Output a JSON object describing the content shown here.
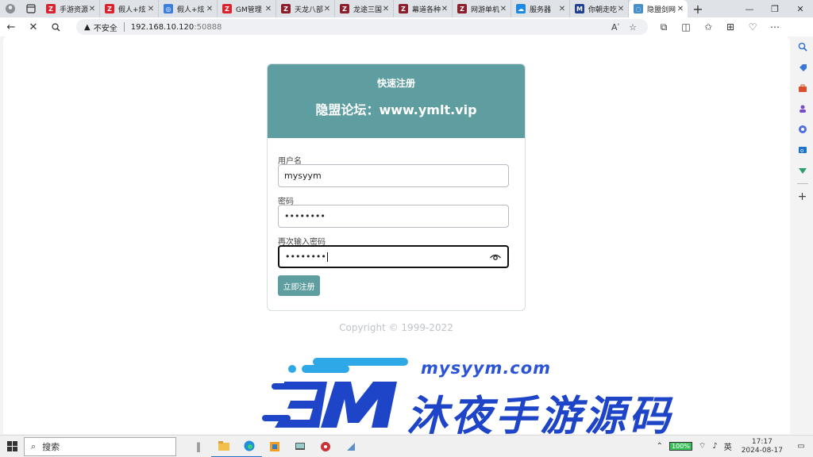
{
  "browser": {
    "tabs": [
      {
        "title": "手游资源",
        "favicon": "Z",
        "color": "#d9232e"
      },
      {
        "title": "假人+炫",
        "favicon": "Z",
        "color": "#d9232e"
      },
      {
        "title": "假人+炫",
        "favicon": "◎",
        "color": "#3b7ddd"
      },
      {
        "title": "GM管理",
        "favicon": "Z",
        "color": "#d9232e"
      },
      {
        "title": "天龙八部",
        "favicon": "Z",
        "color": "#8b1e2a"
      },
      {
        "title": "龙途三国",
        "favicon": "Z",
        "color": "#8b1e2a"
      },
      {
        "title": "幕道各种",
        "favicon": "Z",
        "color": "#8b1e2a"
      },
      {
        "title": "网游单机",
        "favicon": "Z",
        "color": "#8b1e2a"
      },
      {
        "title": "服务器",
        "favicon": "☁",
        "color": "#1e88e5"
      },
      {
        "title": "你朝走吃",
        "favicon": "M",
        "color": "#1f3f8f"
      },
      {
        "title": "隐盟剑网",
        "favicon": "◌",
        "color": "#4a90c8",
        "active": true
      }
    ],
    "address": {
      "security_label": "不安全",
      "host": "192.168.10.120",
      "port": ":50888"
    }
  },
  "form": {
    "title": "快速注册",
    "subtitle": "隐盟论坛：www.ymlt.vip",
    "username_label": "用户名",
    "username_value": "mysyym",
    "password_label": "密码",
    "password_value": "••••••••",
    "confirm_label": "再次输入密码",
    "confirm_value": "••••••••",
    "submit_label": "立即注册",
    "copyright": "Copyright © 1999-2022",
    "header_color": "#5f9ea0"
  },
  "watermark": {
    "url": "mysyym.com",
    "name": "沐夜手游源码"
  },
  "taskbar": {
    "search_placeholder": "搜索",
    "battery": "100%",
    "time": "17:17",
    "date": "2024-08-17"
  }
}
